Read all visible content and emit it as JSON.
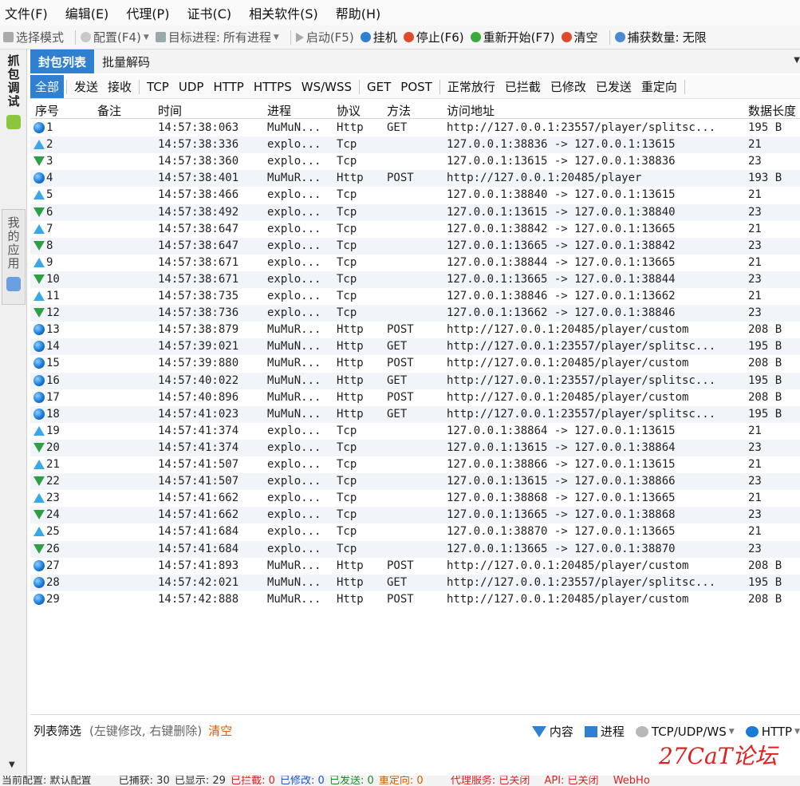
{
  "menubar": [
    "文件(F)",
    "编辑(E)",
    "代理(P)",
    "证书(C)",
    "相关软件(S)",
    "帮助(H)"
  ],
  "toolbar": {
    "select_mode": "选择模式",
    "config": "配置(F4)",
    "target_label": "目标进程:",
    "target_value": "所有进程",
    "start": "启动(F5)",
    "hang": "挂机",
    "stop": "停止(F6)",
    "restart": "重新开始(F7)",
    "clear": "清空",
    "capture_label": "捕获数量:",
    "capture_value": "无限"
  },
  "left_tabs": {
    "capture": [
      "抓",
      "包",
      "调",
      "试"
    ],
    "myapps": [
      "我",
      "的",
      "应",
      "用"
    ]
  },
  "top_tabs": [
    "封包列表",
    "批量解码"
  ],
  "filters": [
    "全部",
    "发送",
    "接收",
    "TCP",
    "UDP",
    "HTTP",
    "HTTPS",
    "WS/WSS",
    "GET",
    "POST",
    "正常放行",
    "已拦截",
    "已修改",
    "已发送",
    "重定向"
  ],
  "columns": [
    "序号",
    "备注",
    "时间",
    "进程",
    "协议",
    "方法",
    "访问地址",
    "数据长度"
  ],
  "rows": [
    {
      "icon": "globe",
      "no": "1",
      "time": "14:57:38:063",
      "proc": "MuMuN...",
      "proto": "Http",
      "method": "GET",
      "url": "http://127.0.0.1:23557/player/splitsc...",
      "len": "195 B"
    },
    {
      "icon": "up",
      "no": "2",
      "time": "14:57:38:336",
      "proc": "explo...",
      "proto": "Tcp",
      "method": "",
      "url": "127.0.0.1:38836 -> 127.0.0.1:13615",
      "len": "21"
    },
    {
      "icon": "down",
      "no": "3",
      "time": "14:57:38:360",
      "proc": "explo...",
      "proto": "Tcp",
      "method": "",
      "url": "127.0.0.1:13615 -> 127.0.0.1:38836",
      "len": "23"
    },
    {
      "icon": "globe",
      "no": "4",
      "time": "14:57:38:401",
      "proc": "MuMuR...",
      "proto": "Http",
      "method": "POST",
      "url": "http://127.0.0.1:20485/player",
      "len": "193 B"
    },
    {
      "icon": "up",
      "no": "5",
      "time": "14:57:38:466",
      "proc": "explo...",
      "proto": "Tcp",
      "method": "",
      "url": "127.0.0.1:38840 -> 127.0.0.1:13615",
      "len": "21"
    },
    {
      "icon": "down",
      "no": "6",
      "time": "14:57:38:492",
      "proc": "explo...",
      "proto": "Tcp",
      "method": "",
      "url": "127.0.0.1:13615 -> 127.0.0.1:38840",
      "len": "23"
    },
    {
      "icon": "up",
      "no": "7",
      "time": "14:57:38:647",
      "proc": "explo...",
      "proto": "Tcp",
      "method": "",
      "url": "127.0.0.1:38842 -> 127.0.0.1:13665",
      "len": "21"
    },
    {
      "icon": "down",
      "no": "8",
      "time": "14:57:38:647",
      "proc": "explo...",
      "proto": "Tcp",
      "method": "",
      "url": "127.0.0.1:13665 -> 127.0.0.1:38842",
      "len": "23"
    },
    {
      "icon": "up",
      "no": "9",
      "time": "14:57:38:671",
      "proc": "explo...",
      "proto": "Tcp",
      "method": "",
      "url": "127.0.0.1:38844 -> 127.0.0.1:13665",
      "len": "21"
    },
    {
      "icon": "down",
      "no": "10",
      "time": "14:57:38:671",
      "proc": "explo...",
      "proto": "Tcp",
      "method": "",
      "url": "127.0.0.1:13665 -> 127.0.0.1:38844",
      "len": "23"
    },
    {
      "icon": "up",
      "no": "11",
      "time": "14:57:38:735",
      "proc": "explo...",
      "proto": "Tcp",
      "method": "",
      "url": "127.0.0.1:38846 -> 127.0.0.1:13662",
      "len": "21"
    },
    {
      "icon": "down",
      "no": "12",
      "time": "14:57:38:736",
      "proc": "explo...",
      "proto": "Tcp",
      "method": "",
      "url": "127.0.0.1:13662 -> 127.0.0.1:38846",
      "len": "23"
    },
    {
      "icon": "globe",
      "no": "13",
      "time": "14:57:38:879",
      "proc": "MuMuR...",
      "proto": "Http",
      "method": "POST",
      "url": "http://127.0.0.1:20485/player/custom",
      "len": "208 B"
    },
    {
      "icon": "globe",
      "no": "14",
      "time": "14:57:39:021",
      "proc": "MuMuN...",
      "proto": "Http",
      "method": "GET",
      "url": "http://127.0.0.1:23557/player/splitsc...",
      "len": "195 B"
    },
    {
      "icon": "globe",
      "no": "15",
      "time": "14:57:39:880",
      "proc": "MuMuR...",
      "proto": "Http",
      "method": "POST",
      "url": "http://127.0.0.1:20485/player/custom",
      "len": "208 B"
    },
    {
      "icon": "globe",
      "no": "16",
      "time": "14:57:40:022",
      "proc": "MuMuN...",
      "proto": "Http",
      "method": "GET",
      "url": "http://127.0.0.1:23557/player/splitsc...",
      "len": "195 B"
    },
    {
      "icon": "globe",
      "no": "17",
      "time": "14:57:40:896",
      "proc": "MuMuR...",
      "proto": "Http",
      "method": "POST",
      "url": "http://127.0.0.1:20485/player/custom",
      "len": "208 B"
    },
    {
      "icon": "globe",
      "no": "18",
      "time": "14:57:41:023",
      "proc": "MuMuN...",
      "proto": "Http",
      "method": "GET",
      "url": "http://127.0.0.1:23557/player/splitsc...",
      "len": "195 B"
    },
    {
      "icon": "up",
      "no": "19",
      "time": "14:57:41:374",
      "proc": "explo...",
      "proto": "Tcp",
      "method": "",
      "url": "127.0.0.1:38864 -> 127.0.0.1:13615",
      "len": "21"
    },
    {
      "icon": "down",
      "no": "20",
      "time": "14:57:41:374",
      "proc": "explo...",
      "proto": "Tcp",
      "method": "",
      "url": "127.0.0.1:13615 -> 127.0.0.1:38864",
      "len": "23"
    },
    {
      "icon": "up",
      "no": "21",
      "time": "14:57:41:507",
      "proc": "explo...",
      "proto": "Tcp",
      "method": "",
      "url": "127.0.0.1:38866 -> 127.0.0.1:13615",
      "len": "21"
    },
    {
      "icon": "down",
      "no": "22",
      "time": "14:57:41:507",
      "proc": "explo...",
      "proto": "Tcp",
      "method": "",
      "url": "127.0.0.1:13615 -> 127.0.0.1:38866",
      "len": "23"
    },
    {
      "icon": "up",
      "no": "23",
      "time": "14:57:41:662",
      "proc": "explo...",
      "proto": "Tcp",
      "method": "",
      "url": "127.0.0.1:38868 -> 127.0.0.1:13665",
      "len": "21"
    },
    {
      "icon": "down",
      "no": "24",
      "time": "14:57:41:662",
      "proc": "explo...",
      "proto": "Tcp",
      "method": "",
      "url": "127.0.0.1:13665 -> 127.0.0.1:38868",
      "len": "23"
    },
    {
      "icon": "up",
      "no": "25",
      "time": "14:57:41:684",
      "proc": "explo...",
      "proto": "Tcp",
      "method": "",
      "url": "127.0.0.1:38870 -> 127.0.0.1:13665",
      "len": "21"
    },
    {
      "icon": "down",
      "no": "26",
      "time": "14:57:41:684",
      "proc": "explo...",
      "proto": "Tcp",
      "method": "",
      "url": "127.0.0.1:13665 -> 127.0.0.1:38870",
      "len": "23"
    },
    {
      "icon": "globe",
      "no": "27",
      "time": "14:57:41:893",
      "proc": "MuMuR...",
      "proto": "Http",
      "method": "POST",
      "url": "http://127.0.0.1:20485/player/custom",
      "len": "208 B"
    },
    {
      "icon": "globe",
      "no": "28",
      "time": "14:57:42:021",
      "proc": "MuMuN...",
      "proto": "Http",
      "method": "GET",
      "url": "http://127.0.0.1:23557/player/splitsc...",
      "len": "195 B"
    },
    {
      "icon": "globe",
      "no": "29",
      "time": "14:57:42:888",
      "proc": "MuMuR...",
      "proto": "Http",
      "method": "POST",
      "url": "http://127.0.0.1:20485/player/custom",
      "len": "208 B"
    }
  ],
  "list_filter": {
    "label": "列表筛选",
    "hint": "(左键修改, 右键删除)",
    "clear": "清空",
    "content": "内容",
    "process": "进程",
    "tcp": "TCP/UDP/WS",
    "http": "HTTP"
  },
  "watermark": "27CaT论坛",
  "statusbar": {
    "config": "当前配置: 默认配置",
    "captured": "已捕获: 30",
    "shown": "已显示: 29",
    "blocked": "已拦截: 0",
    "modified": "已修改: 0",
    "sent": "已发送: 0",
    "redirect": "重定向: 0",
    "proxy": "代理服务: 已关闭",
    "api": "API: 已关闭",
    "webhook": "WebHo"
  },
  "colors": {
    "accent": "#2f80d0",
    "tcp_up": "#3aa8e8",
    "tcp_down": "#2ea043",
    "row_alt": "#f1f5fa",
    "warn": "#e02020"
  }
}
